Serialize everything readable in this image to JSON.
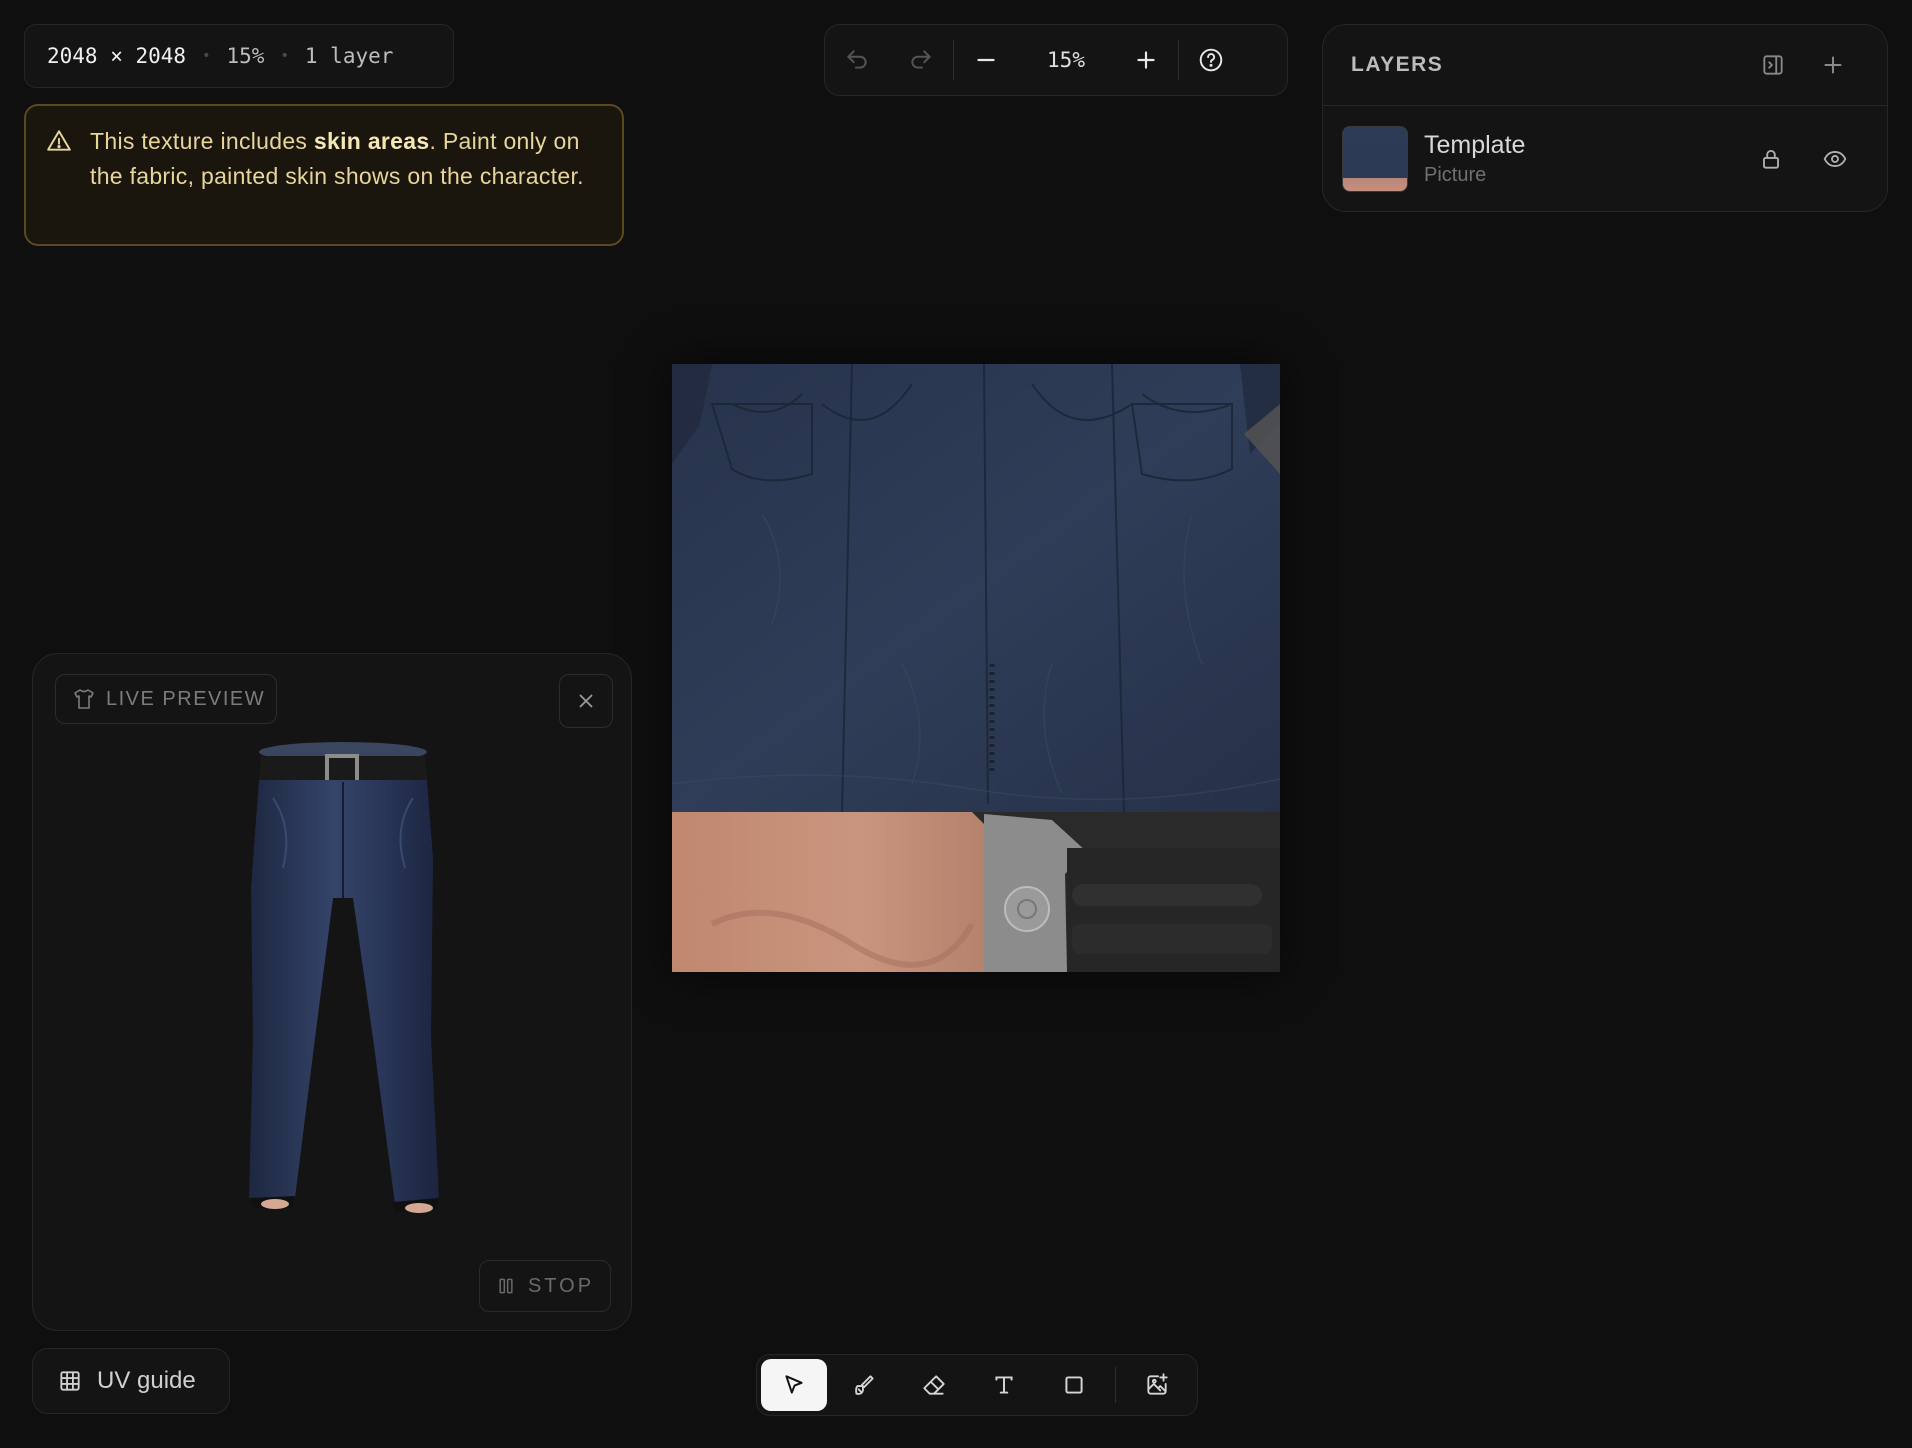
{
  "info": {
    "dimensions": "2048 × 2048",
    "zoom": "15%",
    "layers": "1 layer"
  },
  "warning": {
    "pre": "This texture includes ",
    "bold": "skin areas",
    "post": ". Paint only on the fabric, painted skin shows on the character."
  },
  "toolbar": {
    "zoom": "15%"
  },
  "layers_panel": {
    "title": "LAYERS",
    "items": [
      {
        "name": "Template",
        "type": "Picture"
      }
    ]
  },
  "preview": {
    "label": "LIVE PREVIEW",
    "stop_label": "STOP"
  },
  "uv_guide": {
    "label": "UV guide"
  },
  "colors": {
    "background": "#0f0f0f",
    "panel": "#141414",
    "denim": "#2b3852",
    "skin": "#c48e77",
    "warning": "#e7d59a"
  },
  "icons": {
    "warning": "warning-triangle-icon",
    "undo": "undo-icon",
    "redo": "redo-icon",
    "zoom_out": "minus-icon",
    "zoom_in": "plus-icon",
    "help": "help-circle-icon",
    "panel_toggle": "panel-collapse-icon",
    "add_layer": "plus-icon",
    "lock": "lock-icon",
    "visibility": "eye-icon",
    "shirt": "shirt-icon",
    "close": "close-icon",
    "stop": "pause-icon",
    "grid": "grid-icon",
    "tools": [
      "cursor-icon",
      "brush-icon",
      "eraser-icon",
      "text-icon",
      "rectangle-icon",
      "image-add-icon"
    ]
  }
}
